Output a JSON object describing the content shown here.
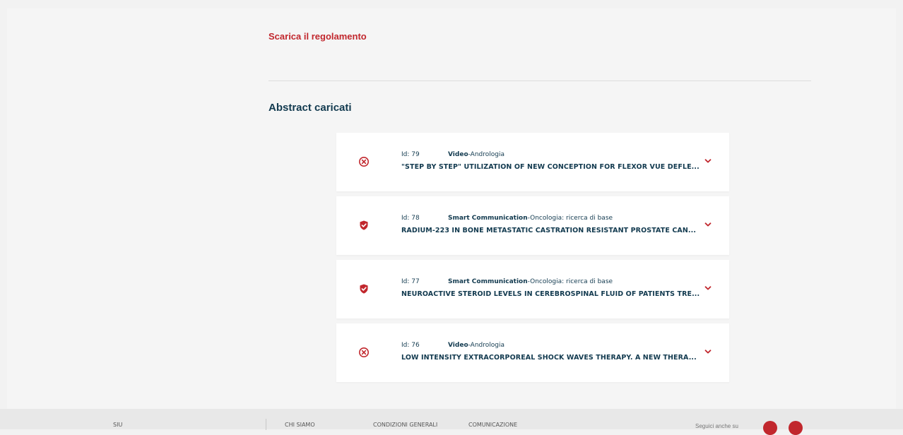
{
  "download_link": "Scarica il regolamento",
  "section_title": "Abstract caricati",
  "abstracts": [
    {
      "id": "Id: 79",
      "type": "Video",
      "category": "-Andrologia",
      "title": "\"STEP BY STEP\" UTILIZATION OF NEW CONCEPTION FOR FLEXOR VUE DEFLE...",
      "status": "rejected"
    },
    {
      "id": "Id: 78",
      "type": "Smart Communication",
      "category": "-Oncologia: ricerca di base",
      "title": "RADIUM-223 IN BONE METASTATIC CASTRATION RESISTANT PROSTATE CAN...",
      "status": "accepted"
    },
    {
      "id": "Id: 77",
      "type": "Smart Communication",
      "category": "-Oncologia: ricerca di base",
      "title": "NEUROACTIVE STEROID LEVELS IN CEREBROSPINAL FLUID OF PATIENTS TRE...",
      "status": "accepted"
    },
    {
      "id": "Id: 76",
      "type": "Video",
      "category": "-Andrologia",
      "title": "LOW INTENSITY EXTRACORPOREAL SHOCK WAVES THERAPY. A NEW THERA...",
      "status": "rejected"
    }
  ],
  "footer": {
    "brand": "SIU",
    "links": [
      "CHI SIAMO",
      "CONDIZIONI GENERALI",
      "COMUNICAZIONE"
    ],
    "follow": "Seguici anche su",
    "social": [
      "facebook-icon",
      "twitter-icon"
    ]
  },
  "colors": {
    "accent": "#c1272d",
    "text": "#123a4f",
    "background": "#f5f5f5"
  }
}
